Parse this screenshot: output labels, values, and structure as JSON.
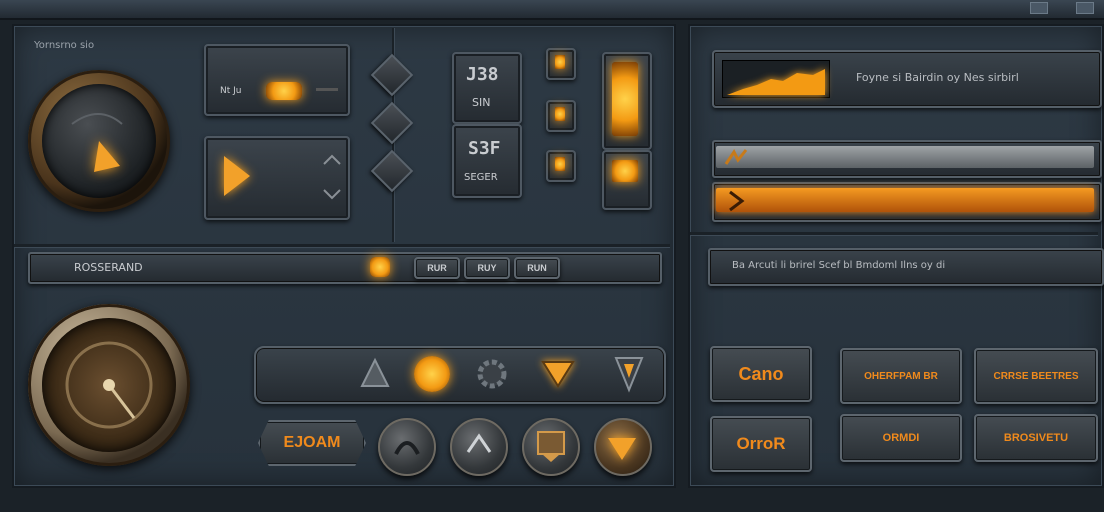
{
  "colors": {
    "accent": "#f39a13",
    "panel": "#2d3944",
    "frame": "#151b21",
    "text": "#c9ccd0"
  },
  "left_panel": {
    "caption": "Yornsrno sio",
    "small_box_label": "Nt Ju",
    "stat_box_1": {
      "big": "J38",
      "small": "SIN"
    },
    "stat_box_2": {
      "big": "S3F",
      "small": "SEGER"
    }
  },
  "slider": {
    "label": "ROSSERAND",
    "tabs": [
      "RUR",
      "RUY",
      "RUN"
    ]
  },
  "right_panel": {
    "graph_caption": "Foyne si Bairdin oy Nes sirbirl",
    "status_text": "Ba Arcuti li brirel Scef bl Bmdoml Ilns oy di",
    "buttons": [
      {
        "label": "Cano"
      },
      {
        "label": "OHERFPAM BR"
      },
      {
        "label": "CRRSE BEETRES"
      },
      {
        "label": "OrroR"
      },
      {
        "label": "ORMDI"
      },
      {
        "label": "BROSIVETU"
      }
    ]
  },
  "bottom_left": {
    "main_button": "EJOAM",
    "icons": [
      "triangle-icon",
      "orb-icon",
      "gear-icon",
      "chevron-down-icon",
      "arrow-down-icon"
    ],
    "round_icons": [
      "arc-icon",
      "caret-up-icon",
      "map-icon",
      "chevron-icon"
    ]
  }
}
